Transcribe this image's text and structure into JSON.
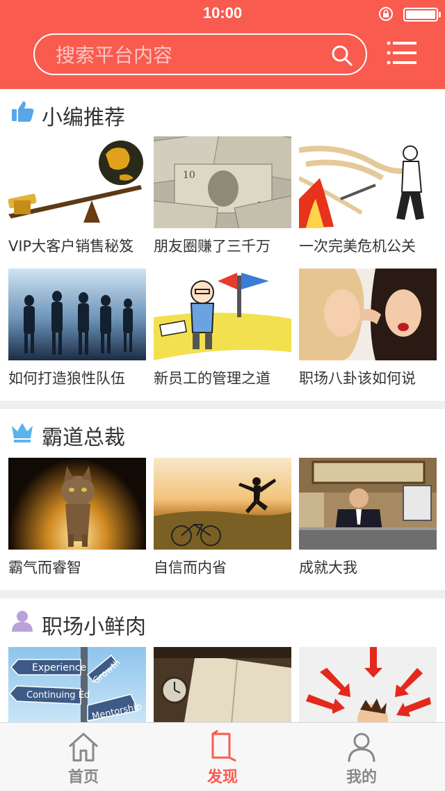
{
  "status_bar": {
    "time": "10:00"
  },
  "header": {
    "search_placeholder": "搜索平台内容"
  },
  "colors": {
    "accent": "#f95b4f",
    "background": "#efefef",
    "tab_inactive": "#888888"
  },
  "sections": [
    {
      "title": "小编推荐",
      "icon": "thumbs-up-icon",
      "items": [
        {
          "caption": "VIP大客户销售秘笈",
          "image": "seesaw-globe-image"
        },
        {
          "caption": "朋友圈赚了三千万",
          "image": "dollar-bills-image"
        },
        {
          "caption": "一次完美危机公关",
          "image": "firefighter-cartoon-image"
        },
        {
          "caption": "如何打造狼性队伍",
          "image": "business-team-silhouette-image"
        },
        {
          "caption": "新员工的管理之道",
          "image": "new-employee-crossroad-image"
        },
        {
          "caption": "职场八卦该如何说",
          "image": "women-whispering-image"
        }
      ]
    },
    {
      "title": "霸道总裁",
      "icon": "crown-icon",
      "items": [
        {
          "caption": "霸气而睿智",
          "image": "cat-walking-image"
        },
        {
          "caption": "自信而内省",
          "image": "jumping-man-sunset-image"
        },
        {
          "caption": "成就大我",
          "image": "executive-desk-image"
        }
      ]
    },
    {
      "title": "职场小鲜肉",
      "icon": "person-icon",
      "items": [
        {
          "caption": "",
          "image": "signpost-image",
          "sign_texts": [
            "Experience",
            "Growth",
            "Continuing Ed",
            "Mentorship"
          ]
        },
        {
          "caption": "",
          "image": "notebook-watch-image"
        },
        {
          "caption": "",
          "image": "arrows-stressed-man-image"
        }
      ]
    }
  ],
  "tabbar": {
    "tabs": [
      {
        "label": "首页",
        "icon": "home-icon",
        "active": false
      },
      {
        "label": "发现",
        "icon": "discover-icon",
        "active": true
      },
      {
        "label": "我的",
        "icon": "user-icon",
        "active": false
      }
    ]
  }
}
